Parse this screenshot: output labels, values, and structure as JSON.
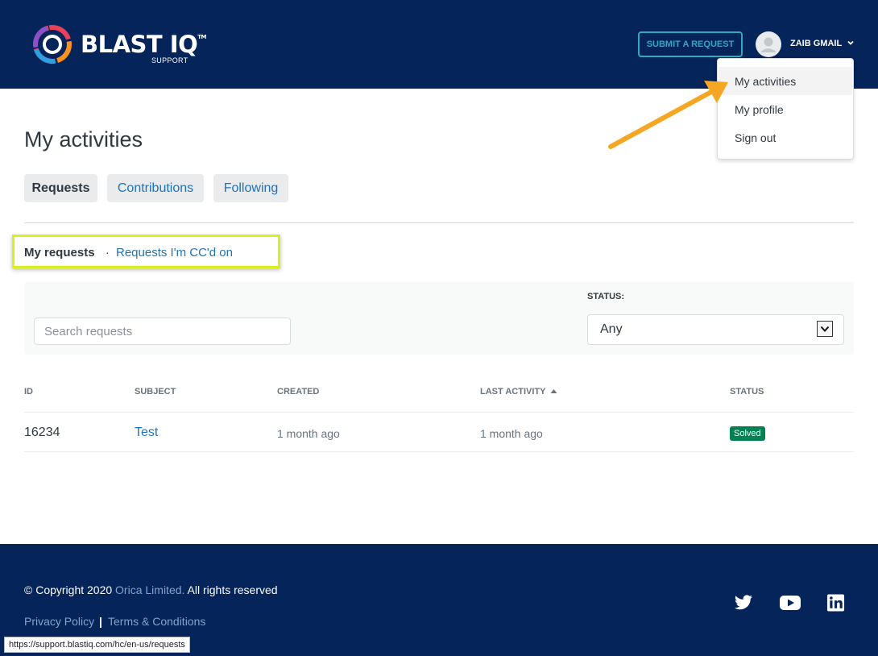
{
  "header": {
    "logo_text": "BLAST IQ",
    "logo_tm": "TM",
    "logo_sub": "SUPPORT",
    "submit_label": "SUBMIT A REQUEST",
    "user_name": "ZAIB GMAIL"
  },
  "user_menu": {
    "items": [
      {
        "label": "My activities",
        "active": true
      },
      {
        "label": "My profile"
      },
      {
        "label": "Sign out"
      }
    ]
  },
  "page": {
    "title": "My activities",
    "tabs": [
      {
        "label": "Requests",
        "active": true
      },
      {
        "label": "Contributions"
      },
      {
        "label": "Following"
      }
    ],
    "sub_nav": {
      "mine": "My requests",
      "separator": "·",
      "cc": "Requests I'm CC'd on"
    }
  },
  "filters": {
    "search_placeholder": "Search requests",
    "status_label": "STATUS:",
    "status_value": "Any"
  },
  "table": {
    "headers": [
      "ID",
      "SUBJECT",
      "CREATED",
      "LAST ACTIVITY",
      "STATUS"
    ],
    "sort_column": "LAST ACTIVITY",
    "rows": [
      {
        "id": "16234",
        "subject": "Test",
        "created": "1 month ago",
        "last_activity": "1 month ago",
        "status": "Solved"
      }
    ]
  },
  "footer": {
    "copyright_prefix": "© Copyright 2020 ",
    "company": "Orica Limited.",
    "copyright_suffix": " All rights reserved",
    "links": [
      "Privacy Policy",
      "Terms & Conditions"
    ],
    "link_separator": "|",
    "social": [
      "twitter-icon",
      "youtube-icon",
      "linkedin-icon"
    ]
  },
  "browser_status": "https://support.blastiq.com/hc/en-us/requests",
  "colors": {
    "navy": "#04245a",
    "link": "#1f73b7",
    "accent": "#30aabc",
    "solved": "#038153",
    "arrow": "#f5a623",
    "highlight": "#dbef1e"
  }
}
